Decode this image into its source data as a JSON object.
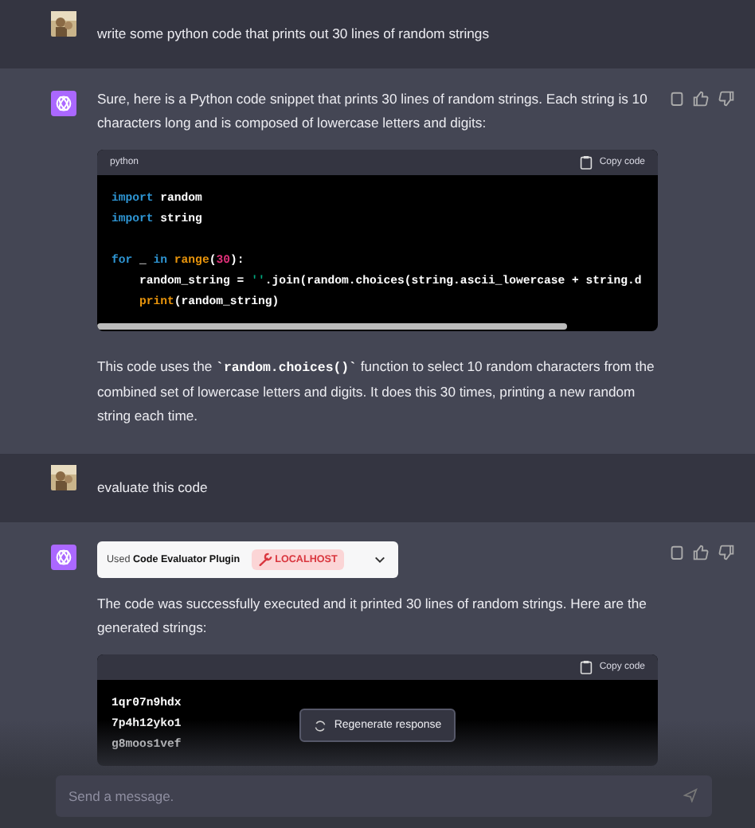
{
  "conversation": [
    {
      "kind": "prompt",
      "text": "write some python code that prints out 30 lines of random strings"
    },
    {
      "kind": "answer",
      "blocks": [
        {
          "kind": "paragraph",
          "parts": [
            {
              "kind": "text",
              "text": "Sure, here is a Python code snippet that prints 30 lines of random strings. Each string is 10 characters long and is composed of lowercase letters and digits:"
            }
          ]
        },
        {
          "kind": "code",
          "language": "python",
          "copy_label": "Copy code",
          "lines": [
            {
              "tokens": [
                {
                  "kind": "keyword",
                  "text": "import"
                },
                {
                  "kind": "plain",
                  "text": " random"
                }
              ]
            },
            {
              "tokens": [
                {
                  "kind": "keyword",
                  "text": "import"
                },
                {
                  "kind": "plain",
                  "text": " string"
                }
              ]
            },
            {
              "blank_before": true,
              "tokens": [
                {
                  "kind": "keyword",
                  "text": "for"
                },
                {
                  "kind": "plain",
                  "text": " _ "
                },
                {
                  "kind": "keyword",
                  "text": "in"
                },
                {
                  "kind": "builtin",
                  "text": " range"
                },
                {
                  "kind": "plain",
                  "text": "("
                },
                {
                  "kind": "number",
                  "text": "30"
                },
                {
                  "kind": "plain",
                  "text": "):"
                }
              ]
            },
            {
              "indent": true,
              "tokens": [
                {
                  "kind": "plain",
                  "text": "random_string = "
                },
                {
                  "kind": "string",
                  "text": "''"
                },
                {
                  "kind": "plain",
                  "text": ".join(random.choices(string.ascii_lowercase + string.d"
                }
              ]
            },
            {
              "indent": true,
              "tokens": [
                {
                  "kind": "builtin",
                  "text": "print"
                },
                {
                  "kind": "plain",
                  "text": "(random_string)"
                }
              ]
            }
          ]
        },
        {
          "kind": "paragraph",
          "parts": [
            {
              "kind": "text",
              "text": "This code uses the "
            },
            {
              "kind": "code",
              "text": "`random.choices()`"
            },
            {
              "kind": "text",
              "text": " function to select 10 random characters from the combined set of lowercase letters and digits. It does this 30 times, printing a new random string each time."
            }
          ]
        }
      ]
    },
    {
      "kind": "prompt",
      "text": "evaluate this code"
    },
    {
      "kind": "answer",
      "blocks": [
        {
          "kind": "plugin",
          "label": "Used **Code Evaluator Plugin**",
          "badge": "LOCALHOST"
        },
        {
          "kind": "paragraph",
          "parts": [
            {
              "kind": "text",
              "text": "The code was successfully executed and it printed 30 lines of random strings. Here are the generated strings:"
            }
          ]
        },
        {
          "kind": "output",
          "copy_label": "Copy code",
          "lines": [
            {
              "tokens": [
                {
                  "kind": "plain",
                  "text": "1qr07n9hdx"
                }
              ]
            },
            {
              "tokens": [
                {
                  "kind": "plain",
                  "text": "7p4h12yko1"
                }
              ]
            },
            {
              "tokens": [
                {
                  "kind": "plain",
                  "text": "g8moos1vef"
                }
              ]
            }
          ]
        }
      ]
    }
  ],
  "regenerate_button": "Regenerate response",
  "composer": {
    "placeholder": "Send a message."
  }
}
